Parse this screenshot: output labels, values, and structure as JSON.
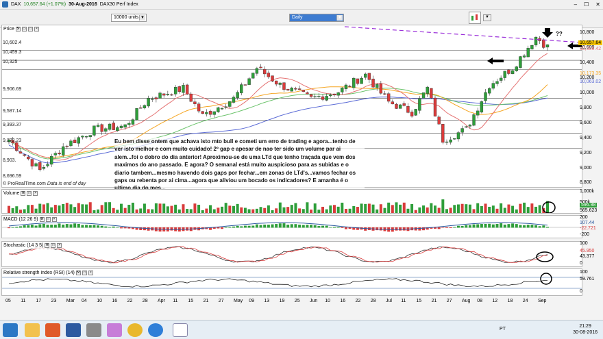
{
  "window": {
    "title_symbol": "DAX",
    "title_quote": "10,657.64 (+1.07%)",
    "title_date": "30-Aug-2016",
    "title_name": "DAX30 Perf Index"
  },
  "toolbar": {
    "units_value": "10000 units",
    "period_value": "Daily"
  },
  "price_panel": {
    "label": "Price",
    "source": "© ProRealTime.com",
    "source_note": "Data is end of day",
    "annotation_q": "??",
    "levels": [
      "10,602.4",
      "10,459.3",
      "10,325",
      "9,906.69",
      "9,587.14",
      "9,393.37",
      "9,172.23",
      "8,903.",
      "8,696.59"
    ],
    "axis_ticks": [
      "10,800",
      "10,600",
      "10,400",
      "10,200",
      "10,000",
      "9,800",
      "9,600",
      "9,400",
      "9,200",
      "9,000",
      "8,800"
    ],
    "tags": [
      {
        "text": "10,657.64",
        "color": "#f6c400"
      },
      {
        "text": "10,556.42",
        "color": "#e57373"
      },
      {
        "text": "10,173.35",
        "color": "#f5a623"
      },
      {
        "text": "10,063.02",
        "color": "#5b6bd6"
      }
    ],
    "comment": "Eu bem disse ontem que achava isto mto bull e cometi um erro de trading e agora...tenho de ver isto melhor e com muito cuidado! 2º gap e apesar de nao ter sido um volume par ai alem...foi o dobro do dia anterior! Aproximou-se de uma LTd que tenho traçada que vem dos maximos do ano passado. E agora? O semanal está muito auspicioso para as subidas e o diario tambem...mesmo havendo dois gaps por fechar...em zonas de LTd's...vamos fechar os gaps ou rebenta por ai cima...agora que aliviou um bocado os indicadores? E amanha é o ultimo dia do mes..."
  },
  "volume_panel": {
    "label": "Volume",
    "axis_ticks": [
      "1,000k",
      "500k"
    ],
    "tags": [
      "596.88",
      "565.623"
    ]
  },
  "macd_panel": {
    "label": "MACD (12 26 9)",
    "axis_ticks": [
      "200",
      "-200"
    ],
    "tags": [
      "107.44",
      "-22.721"
    ]
  },
  "stoch_panel": {
    "label": "Stochastic (14 3 5)",
    "axis_ticks": [
      "100",
      "0"
    ],
    "tags": [
      "45.950",
      "43.377"
    ]
  },
  "rsi_panel": {
    "label": "Relative strength index (RSI) (14)",
    "axis_ticks": [
      "100",
      "0"
    ],
    "tags": [
      "59.761"
    ]
  },
  "x_axis": [
    "05",
    "11",
    "17",
    "23",
    "Mar",
    "04",
    "10",
    "16",
    "22",
    "28",
    "Apr",
    "11",
    "15",
    "21",
    "27",
    "May",
    "09",
    "13",
    "19",
    "25",
    "Jun",
    "10",
    "16",
    "22",
    "28",
    "Jul",
    "11",
    "15",
    "21",
    "27",
    "Aug",
    "08",
    "12",
    "18",
    "24",
    "Sep"
  ],
  "colors": {
    "candle_up": "#2e9e3a",
    "candle_down": "#d93b3b",
    "ma_fast": "#e57373",
    "ma_mid": "#f5a623",
    "ma_slow": "#5b6bd6",
    "ma_green": "#6bc36b",
    "trendline": "#9b30d9"
  },
  "taskbar": {
    "lang": "PT",
    "time": "21:29",
    "date": "30-08-2016"
  }
}
